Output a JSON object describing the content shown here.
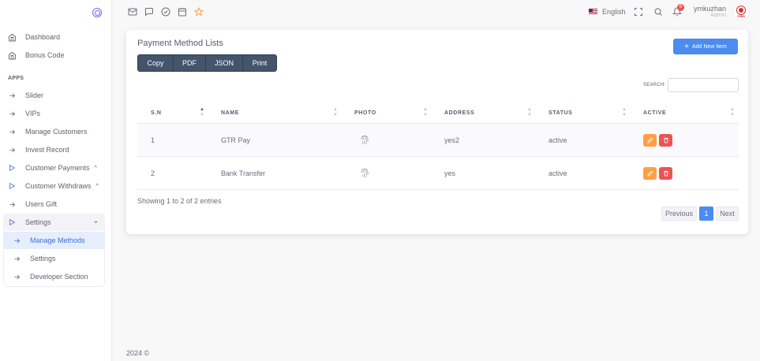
{
  "sidebar": {
    "items": [
      {
        "label": "Dashboard",
        "icon": "home-icon"
      },
      {
        "label": "Bonus Code",
        "icon": "home-icon"
      }
    ],
    "section_label": "APPS",
    "apps": [
      {
        "label": "Slider",
        "icon": "arrow-right-icon"
      },
      {
        "label": "VIPs",
        "icon": "arrow-right-icon"
      },
      {
        "label": "Manage Customers",
        "icon": "arrow-right-icon"
      },
      {
        "label": "Invest Record",
        "icon": "arrow-right-icon"
      },
      {
        "label": "Customer Payments",
        "icon": "triangle-right-icon"
      },
      {
        "label": "Customer Withdraws",
        "icon": "triangle-right-icon"
      },
      {
        "label": "Users Gift",
        "icon": "arrow-right-icon"
      },
      {
        "label": "Settings",
        "icon": "triangle-right-icon"
      }
    ],
    "settings_sub": [
      {
        "label": "Manage Methods",
        "active": true
      },
      {
        "label": "Settings",
        "active": false
      },
      {
        "label": "Developer Section",
        "active": false
      }
    ]
  },
  "header": {
    "language": "English",
    "notification_count": "6",
    "user_name": "ymkuzhan",
    "user_role": "Admin",
    "avatar_text": "CRBS"
  },
  "card": {
    "title": "Payment Method Lists",
    "add_button": "Add New Item",
    "export_buttons": [
      "Copy",
      "PDF",
      "JSON",
      "Print"
    ],
    "search_label": "SEARCH:",
    "search_value": "",
    "columns": [
      "S.N",
      "NAME",
      "PHOTO",
      "ADDRESS",
      "STATUS",
      "ACTIVE"
    ],
    "rows": [
      {
        "sn": "1",
        "name": "GTR Pay",
        "address": "yes2",
        "status": "active"
      },
      {
        "sn": "2",
        "name": "Bank Transfer",
        "address": "yes",
        "status": "active"
      }
    ],
    "info": "Showing 1 to 2 of 2 entries",
    "pagination": {
      "previous": "Previous",
      "current": "1",
      "next": "Next"
    }
  },
  "footer": {
    "text": "2024 ©"
  },
  "colors": {
    "primary": "#4a8cf0",
    "edit": "#ff9f43",
    "delete": "#ea5455",
    "button_dark": "#44546a"
  }
}
